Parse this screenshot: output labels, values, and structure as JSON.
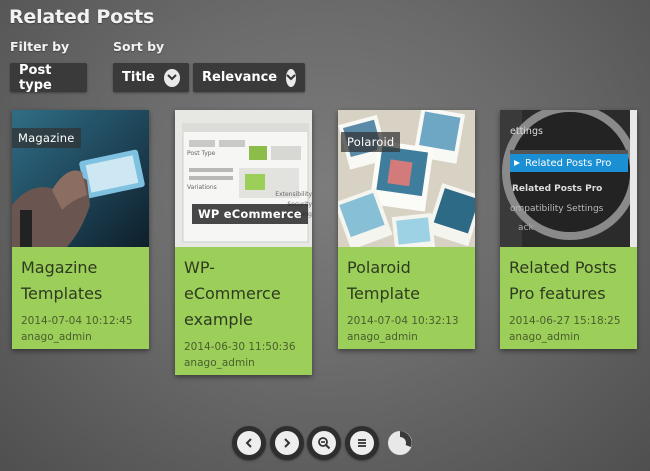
{
  "header": {
    "title": "Related Posts"
  },
  "filter": {
    "label": "Filter by",
    "button_label": "Post type"
  },
  "sort": {
    "label": "Sort by",
    "title_label": "Title",
    "relevance_label": "Relevance"
  },
  "cards": [
    {
      "badge": "Magazine",
      "title_line1": "Magazine",
      "title_line2": "Templates",
      "title_line3": "",
      "date": "2014-07-04 10:12:45",
      "author": "anago_admin"
    },
    {
      "badge": "WP eCommerce",
      "title_line1": "WP-",
      "title_line2": "eCommerce",
      "title_line3": "example",
      "date": "2014-06-30 11:50:36",
      "author": "anago_admin"
    },
    {
      "badge": "Polaroid",
      "title_line1": "Polaroid",
      "title_line2": "Template",
      "title_line3": "",
      "date": "2014-07-04 10:32:13",
      "author": "anago_admin"
    },
    {
      "badge": "",
      "title_line1": "Related Posts",
      "title_line2": "Pro features",
      "title_line3": "",
      "date": "2014-06-27 15:18:25",
      "author": "anago_admin"
    }
  ],
  "card4_screenshot": {
    "item1": "ettings",
    "item2": "Related Posts Pro",
    "item3": "Related Posts Pro",
    "item4": "ompatibility Settings",
    "item5": "ack"
  },
  "card2_screenshot": {
    "line1": "Post Type",
    "line2": "Variations",
    "line3": "Extensibility",
    "line4": "Security Hardening"
  },
  "pagination": {
    "icons": [
      "chevron-left-icon",
      "chevron-right-icon",
      "zoom-out-icon",
      "list-icon",
      "loading-icon"
    ]
  },
  "colors": {
    "card_bg": "#9bcf5a",
    "button_bg": "#3a3a3a",
    "accent_blue": "#1a8fd4"
  }
}
